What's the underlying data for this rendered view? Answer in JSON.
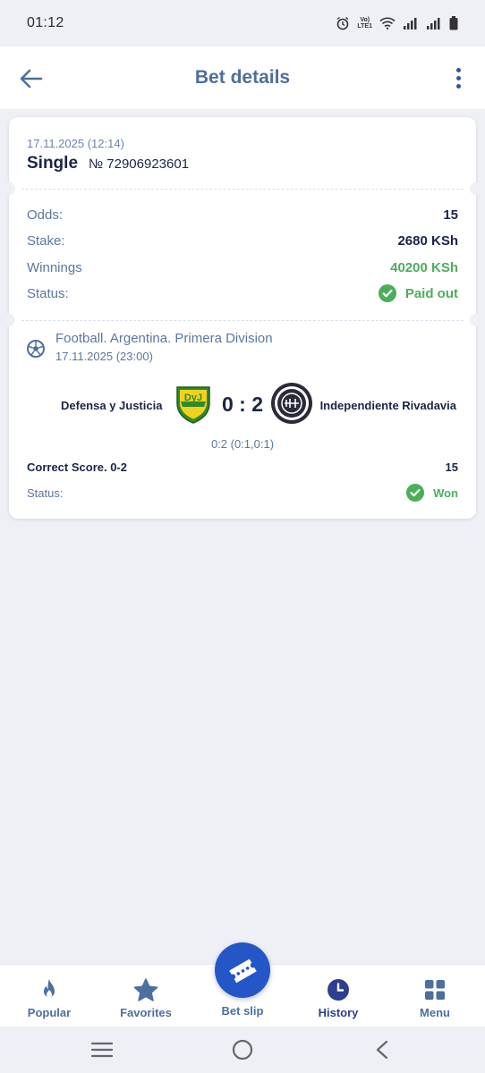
{
  "status_bar": {
    "time": "01:12",
    "network_label_top": "Vo)",
    "network_label_bottom": "LTE1"
  },
  "header": {
    "title": "Bet details"
  },
  "bet": {
    "date": "17.11.2025 (12:14)",
    "type": "Single",
    "number": "№ 72906923601",
    "odds_label": "Odds:",
    "odds_value": "15",
    "stake_label": "Stake:",
    "stake_value": "2680 KSh",
    "winnings_label": "Winnings",
    "winnings_value": "40200 KSh",
    "status_label": "Status:",
    "status_value": "Paid out"
  },
  "event": {
    "league": "Football. Argentina. Primera Division",
    "date": "17.11.2025 (23:00)",
    "home_team": "Defensa y Justicia",
    "away_team": "Independiente Rivadavia",
    "home_score": "0",
    "score_separator": ":",
    "away_score": "2",
    "score_detail": "0:2 (0:1,0:1)",
    "market": "Correct Score. 0-2",
    "market_odds": "15",
    "status_label": "Status:",
    "status_value": "Won"
  },
  "colors": {
    "accent": "#2456c8",
    "success": "#4cae5a",
    "title": "#4d6f9e"
  },
  "bottom_nav": {
    "items": [
      {
        "label": "Popular",
        "icon": "flame-icon"
      },
      {
        "label": "Favorites",
        "icon": "star-icon"
      },
      {
        "label": "Bet slip",
        "icon": "ticket-icon"
      },
      {
        "label": "History",
        "icon": "clock-icon"
      },
      {
        "label": "Menu",
        "icon": "grid-icon"
      }
    ],
    "active": "History"
  }
}
